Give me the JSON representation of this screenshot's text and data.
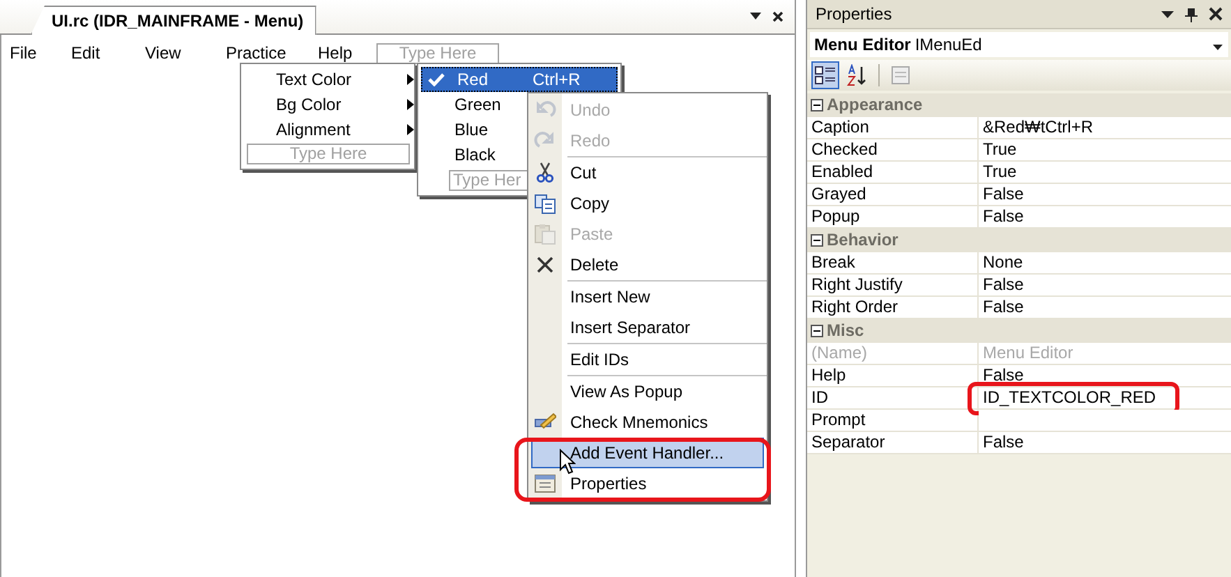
{
  "document_tab": {
    "title": "UI.rc (IDR_MAINFRAME - Menu)"
  },
  "menu_bar": [
    {
      "label": "File"
    },
    {
      "label": "Edit"
    },
    {
      "label": "View"
    },
    {
      "label": "Practice"
    },
    {
      "label": "Help"
    }
  ],
  "menu_bar_placeholder": "Type Here",
  "practice_menu": {
    "items": [
      {
        "label": "Text Color",
        "submenu": true
      },
      {
        "label": "Bg Color",
        "submenu": true
      },
      {
        "label": "Alignment",
        "submenu": true
      }
    ],
    "placeholder": "Type Here"
  },
  "color_menu": {
    "items": [
      {
        "label": "Red",
        "shortcut": "Ctrl+R",
        "checked": true,
        "selected": true
      },
      {
        "label": "Green",
        "checked": false,
        "selected": false
      },
      {
        "label": "Blue",
        "checked": false,
        "selected": false
      },
      {
        "label": "Black",
        "checked": false,
        "selected": false
      }
    ],
    "placeholder": "Type Her"
  },
  "context_menu": [
    {
      "kind": "item",
      "label": "Undo",
      "disabled": true,
      "selected": false
    },
    {
      "kind": "item",
      "label": "Redo",
      "disabled": true,
      "selected": false
    },
    {
      "kind": "separator"
    },
    {
      "kind": "item",
      "label": "Cut",
      "disabled": false,
      "selected": false
    },
    {
      "kind": "item",
      "label": "Copy",
      "disabled": false,
      "selected": false
    },
    {
      "kind": "item",
      "label": "Paste",
      "disabled": true,
      "selected": false
    },
    {
      "kind": "item",
      "label": "Delete",
      "disabled": false,
      "selected": false
    },
    {
      "kind": "separator"
    },
    {
      "kind": "item",
      "label": "Insert New",
      "disabled": false,
      "selected": false
    },
    {
      "kind": "item",
      "label": "Insert Separator",
      "disabled": false,
      "selected": false
    },
    {
      "kind": "separator"
    },
    {
      "kind": "item",
      "label": "Edit IDs",
      "disabled": false,
      "selected": false
    },
    {
      "kind": "separator"
    },
    {
      "kind": "item",
      "label": "View As Popup",
      "disabled": false,
      "selected": false
    },
    {
      "kind": "item",
      "label": "Check Mnemonics",
      "disabled": false,
      "selected": false
    },
    {
      "kind": "item",
      "label": "Add Event Handler...",
      "disabled": false,
      "selected": true,
      "highlighted": true
    },
    {
      "kind": "item",
      "label": "Properties",
      "disabled": false,
      "selected": false
    }
  ],
  "properties_panel": {
    "title": "Properties",
    "object": {
      "name": "Menu Editor",
      "type": "IMenuEd"
    },
    "categories": [
      {
        "name": "Appearance",
        "expanded": true,
        "rows": [
          {
            "name": "Caption",
            "value": "&Red₩tCtrl+R"
          },
          {
            "name": "Checked",
            "value": "True"
          },
          {
            "name": "Enabled",
            "value": "True"
          },
          {
            "name": "Grayed",
            "value": "False"
          },
          {
            "name": "Popup",
            "value": "False"
          }
        ]
      },
      {
        "name": "Behavior",
        "expanded": true,
        "rows": [
          {
            "name": "Break",
            "value": "None"
          },
          {
            "name": "Right Justify",
            "value": "False"
          },
          {
            "name": "Right Order",
            "value": "False"
          }
        ]
      },
      {
        "name": "Misc",
        "expanded": true,
        "rows": [
          {
            "name": "(Name)",
            "value": "Menu Editor",
            "disabled": true
          },
          {
            "name": "Help",
            "value": "False"
          },
          {
            "name": "ID",
            "value": "ID_TEXTCOLOR_RED",
            "highlighted": true
          },
          {
            "name": "Prompt"
          },
          {
            "name": "Separator",
            "value": "False"
          }
        ]
      }
    ]
  }
}
